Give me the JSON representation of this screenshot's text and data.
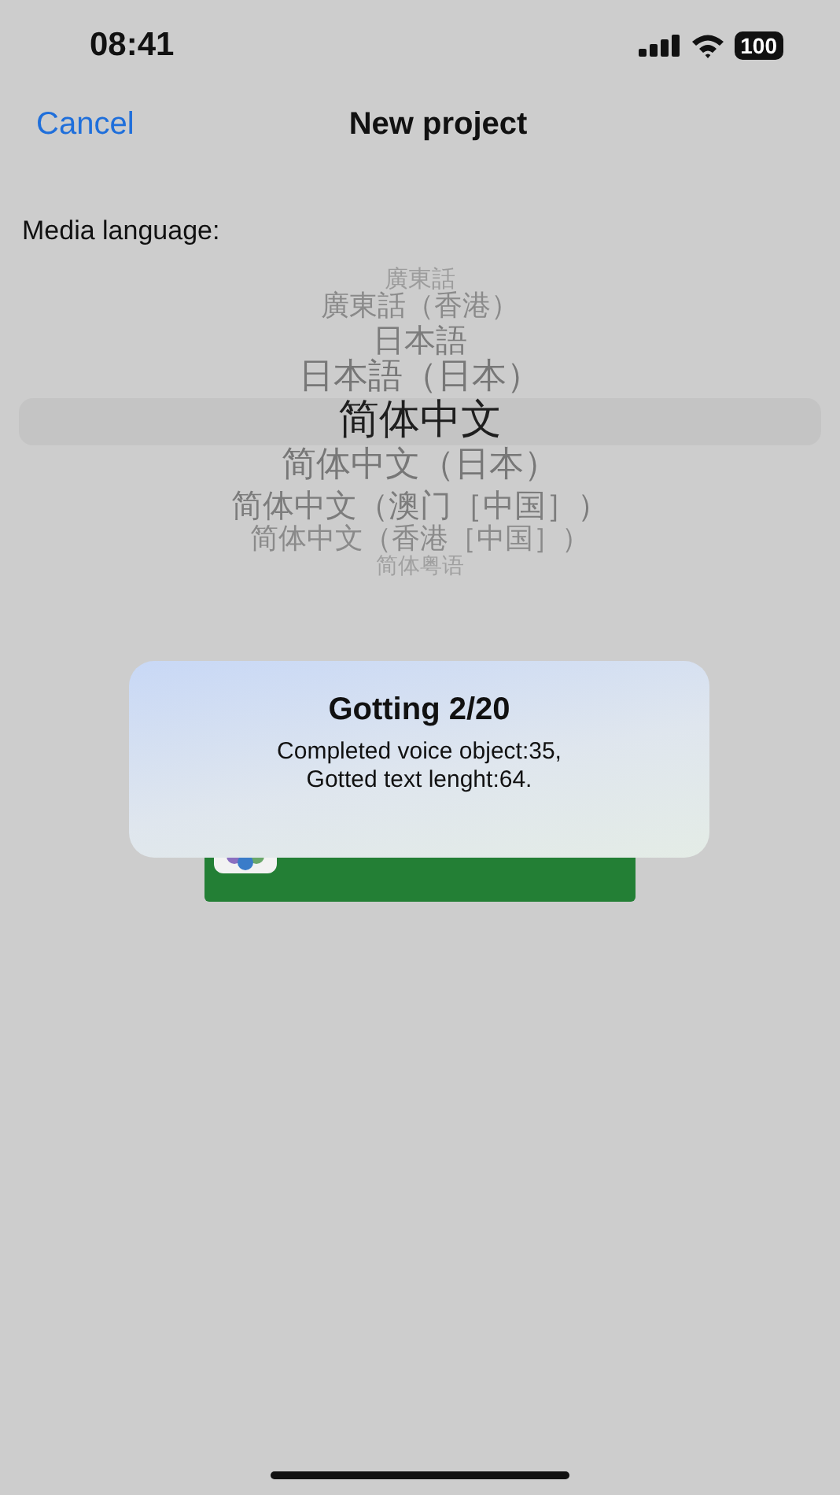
{
  "status_bar": {
    "time": "08:41",
    "battery": "100"
  },
  "nav_bar": {
    "cancel": "Cancel",
    "title": "New project"
  },
  "media_language": {
    "label": "Media language:",
    "options": [
      {
        "label": "廣東話",
        "selected": false
      },
      {
        "label": "廣東話（香港）",
        "selected": false
      },
      {
        "label": "日本語",
        "selected": false
      },
      {
        "label": "日本語（日本）",
        "selected": false
      },
      {
        "label": "简体中文",
        "selected": true
      },
      {
        "label": "简体中文（日本）",
        "selected": false
      },
      {
        "label": "简体中文（澳门［中国］）",
        "selected": false
      },
      {
        "label": "简体中文（香港［中国］）",
        "selected": false
      },
      {
        "label": "简体粤语",
        "selected": false
      }
    ]
  },
  "photos_button": {
    "kind": "covered"
  },
  "toast": {
    "title": "Gotting 2/20",
    "message": "Completed voice object:35,\nGotted text lenght:64."
  }
}
